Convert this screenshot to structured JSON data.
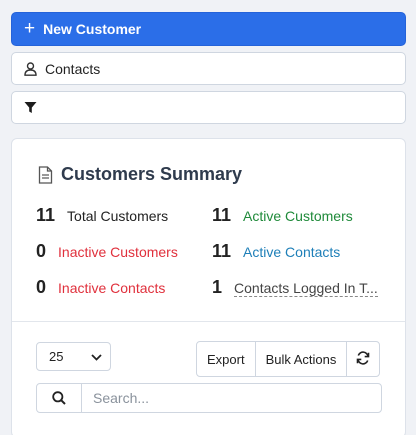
{
  "new_customer_button": {
    "label": "New Customer"
  },
  "contacts_bar": {
    "label": "Contacts"
  },
  "summary": {
    "title": "Customers Summary",
    "stats": [
      {
        "value": "11",
        "label": "Total Customers"
      },
      {
        "value": "11",
        "label": "Active Customers"
      },
      {
        "value": "0",
        "label": "Inactive Customers"
      },
      {
        "value": "11",
        "label": "Active Contacts"
      },
      {
        "value": "0",
        "label": "Inactive Contacts"
      },
      {
        "value": "1",
        "label": "Contacts Logged In T..."
      }
    ]
  },
  "table_controls": {
    "page_size": "25",
    "export_label": "Export",
    "bulk_actions_label": "Bulk Actions",
    "search_placeholder": "Search..."
  },
  "colors": {
    "primary": "#2b6ee8",
    "active_green": "#1f8a3a",
    "inactive_red": "#e0303c",
    "active_blue": "#1e7fb8"
  },
  "icons": [
    "plus-icon",
    "user-icon",
    "filter-icon",
    "document-icon",
    "chevron-down-icon",
    "refresh-icon",
    "search-icon"
  ]
}
